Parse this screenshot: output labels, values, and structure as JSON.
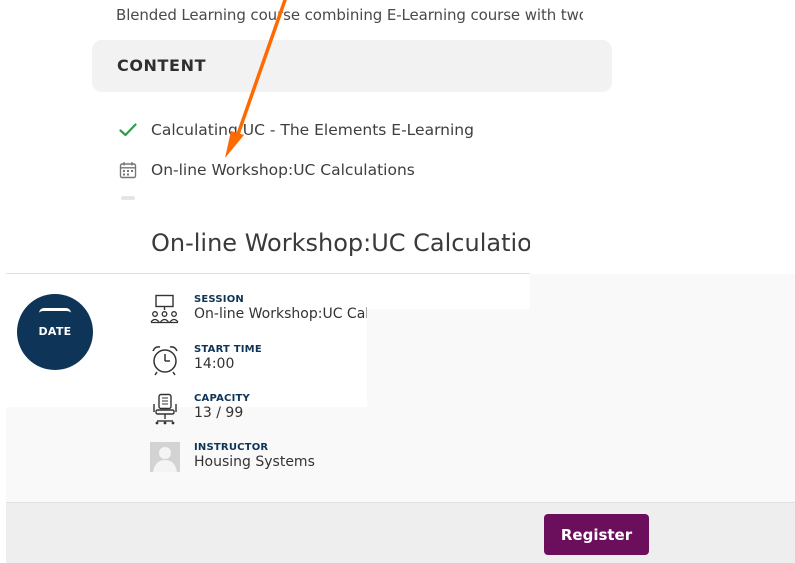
{
  "course": {
    "description": "Blended Learning course combining E-Learning course with two",
    "content_header": "CONTENT",
    "items": [
      {
        "icon": "checkmark-icon",
        "label": "Calculating UC - The Elements E-Learning",
        "status": "completed"
      },
      {
        "icon": "calendar-icon",
        "label": "On-line Workshop:UC Calculations",
        "status": "scheduled"
      }
    ]
  },
  "session_card": {
    "title": "On-line Workshop:UC Calculations",
    "date_label": "DATE",
    "fields": {
      "session": {
        "label": "SESSION",
        "value": "On-line Workshop:UC Calculations",
        "icon": "presentation-icon"
      },
      "start_time": {
        "label": "START TIME",
        "value": "14:00",
        "icon": "alarm-clock-icon"
      },
      "capacity": {
        "label": "CAPACITY",
        "value": "13 / 99",
        "icon": "office-chair-icon"
      },
      "instructor": {
        "label": "INSTRUCTOR",
        "value": "Housing Systems",
        "icon": "avatar-placeholder-icon"
      }
    },
    "register_label": "Register"
  },
  "annotation": {
    "arrow_color": "#ff6a00"
  },
  "colors": {
    "brand_navy": "#0e3457",
    "register_purple": "#6b0f5c",
    "check_green": "#2e9d4e"
  }
}
